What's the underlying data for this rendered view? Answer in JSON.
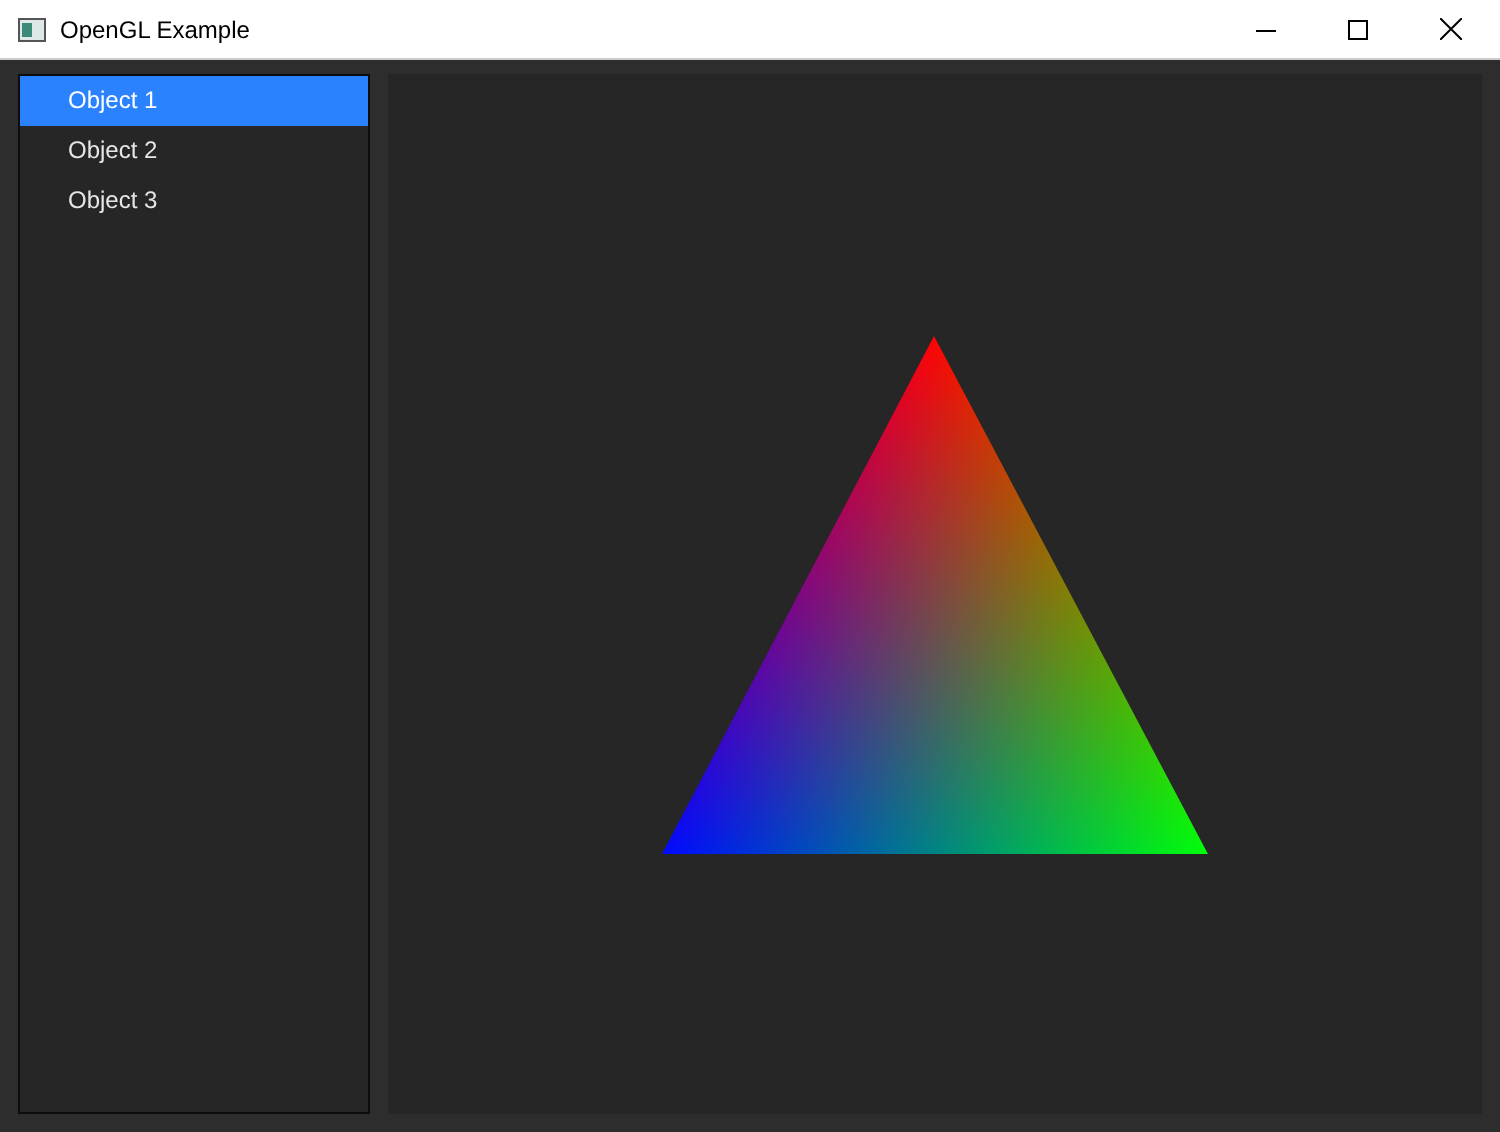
{
  "window": {
    "title": "OpenGL Example"
  },
  "object_list": [
    {
      "label": "Object 1",
      "selected": true
    },
    {
      "label": "Object 2",
      "selected": false
    },
    {
      "label": "Object 3",
      "selected": false
    }
  ]
}
